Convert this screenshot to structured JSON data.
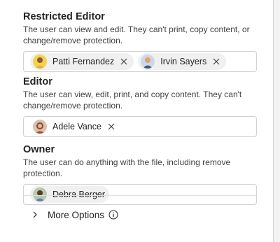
{
  "roles": [
    {
      "title": "Restricted Editor",
      "description": "The user can view and edit. They can't print, copy content, or change/remove protection.",
      "people": [
        {
          "name": "Patti Fernandez",
          "removable": true
        },
        {
          "name": "Irvin Sayers",
          "removable": true
        }
      ]
    },
    {
      "title": "Editor",
      "description": "The user can view, edit, print, and copy content. They can't change/remove protection.",
      "people": [
        {
          "name": "Adele Vance",
          "removable": true
        }
      ]
    },
    {
      "title": "Owner",
      "description": "The user can do anything with the file, including remove protection.",
      "people": [
        {
          "name": "Debra Berger",
          "removable": false
        }
      ]
    }
  ],
  "more_options": {
    "label": "More Options",
    "chevron_icon": "chevron-right-icon",
    "info_icon": "info-icon"
  },
  "icons": {
    "remove": "close-icon"
  },
  "colors": {
    "panel_bg": "#ffffff",
    "page_bg": "#f3f3f3",
    "chip_bg": "#f0f0f0",
    "border": "#d1d1d1"
  }
}
